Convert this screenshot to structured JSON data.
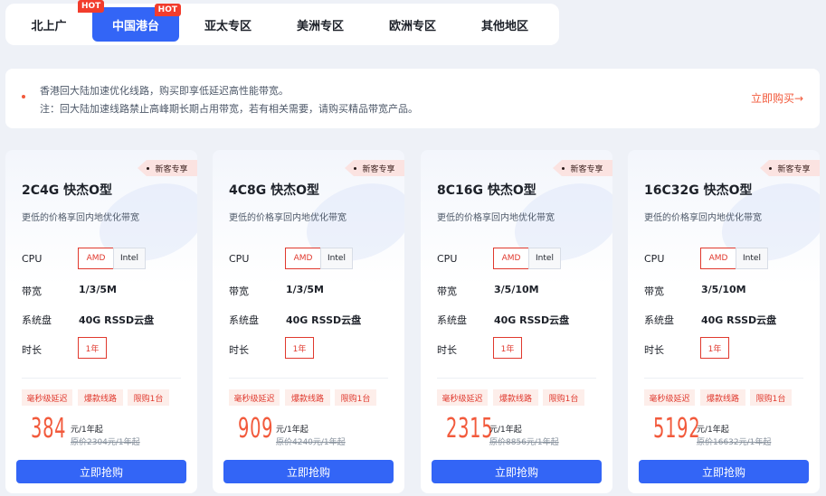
{
  "tabs": [
    {
      "label": "北上广",
      "active": false,
      "hot": false
    },
    {
      "label": "中国港台",
      "active": true,
      "hot": true
    },
    {
      "label": "亚太专区",
      "active": false,
      "hot": false
    },
    {
      "label": "美洲专区",
      "active": false,
      "hot": false
    },
    {
      "label": "欧洲专区",
      "active": false,
      "hot": false
    },
    {
      "label": "其他地区",
      "active": false,
      "hot": false
    }
  ],
  "hot_badge": "HOT",
  "notice": {
    "line1": "香港回大陆加速优化线路，购买即享低延迟高性能带宽。",
    "line2": "注：回大陆加速线路禁止高峰期长期占用带宽，若有相关需要，请购买精品带宽产品。",
    "link": "立即购买→"
  },
  "labels": {
    "cpu": "CPU",
    "bandwidth": "带宽",
    "disk": "系统盘",
    "duration": "时长",
    "new_badge": "新客专享",
    "buy": "立即抢购"
  },
  "products": [
    {
      "title": "2C4G 快杰O型",
      "subtitle": "更低的价格享回内地优化带宽",
      "cpu_options": [
        "AMD",
        "Intel"
      ],
      "cpu_selected": "AMD",
      "bandwidth": "1/3/5M",
      "disk": "40G RSSD云盘",
      "duration": "1年",
      "tags": [
        "毫秒级延迟",
        "爆款线路",
        "限购1台"
      ],
      "price": "384",
      "price_unit": "元/1年起",
      "original": "原价2304元/1年起"
    },
    {
      "title": "4C8G 快杰O型",
      "subtitle": "更低的价格享回内地优化带宽",
      "cpu_options": [
        "AMD",
        "Intel"
      ],
      "cpu_selected": "AMD",
      "bandwidth": "1/3/5M",
      "disk": "40G RSSD云盘",
      "duration": "1年",
      "tags": [
        "毫秒级延迟",
        "爆款线路",
        "限购1台"
      ],
      "price": "909",
      "price_unit": "元/1年起",
      "original": "原价4240元/1年起"
    },
    {
      "title": "8C16G 快杰O型",
      "subtitle": "更低的价格享回内地优化带宽",
      "cpu_options": [
        "AMD",
        "Intel"
      ],
      "cpu_selected": "AMD",
      "bandwidth": "3/5/10M",
      "disk": "40G RSSD云盘",
      "duration": "1年",
      "tags": [
        "毫秒级延迟",
        "爆款线路",
        "限购1台"
      ],
      "price": "2315",
      "price_unit": "元/1年起",
      "original": "原价8856元/1年起"
    },
    {
      "title": "16C32G 快杰O型",
      "subtitle": "更低的价格享回内地优化带宽",
      "cpu_options": [
        "AMD",
        "Intel"
      ],
      "cpu_selected": "AMD",
      "bandwidth": "3/5/10M",
      "disk": "40G RSSD云盘",
      "duration": "1年",
      "tags": [
        "毫秒级延迟",
        "爆款线路",
        "限购1台"
      ],
      "price": "5192",
      "price_unit": "元/1年起",
      "original": "原价16632元/1年起"
    }
  ],
  "colors": {
    "accent": "#3365f6",
    "price": "#f25a3c",
    "selected": "#e0392e",
    "hot": "#f23c2c"
  }
}
